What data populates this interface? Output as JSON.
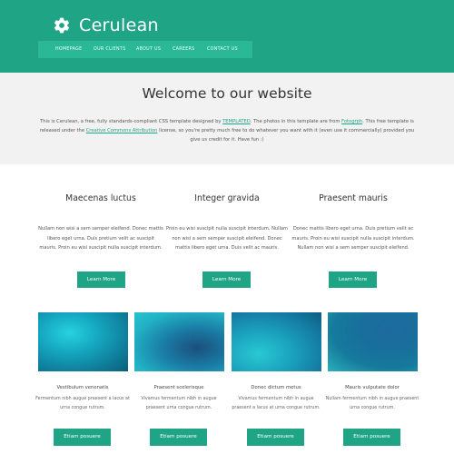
{
  "header": {
    "title": "Cerulean",
    "logo_icon": "gear-icon",
    "nav": [
      "Homepage",
      "Our Clients",
      "About Us",
      "Careers",
      "Contact Us"
    ]
  },
  "banner": {
    "heading": "Welcome to our website",
    "intro_1": "This is Cerulean, a free, fully standards-compliant CSS template designed by ",
    "link_1": "TEMPLATED",
    "intro_2": ". The photos in this template are from ",
    "link_2": "Fotogrph",
    "intro_3": ". This free template is released under the ",
    "link_3": "Creative Commons Attribution",
    "intro_4": " license, so you're pretty much free to do whatever you want with it (even use it commercially) provided you give us credit for it. Have fun :)"
  },
  "features": [
    {
      "title": "Maecenas luctus",
      "text": "Nullam non wisi a sem semper eleifend. Donec mattis libero eget urna. Duis pretium velit ac suscipit mauris. Proin eu wisi suscipit nulla suscipit interdum.",
      "button": "Learn More"
    },
    {
      "title": "Integer gravida",
      "text": "Proin eu wisi suscipit nulla suscipit interdum. Nullam non wisi a sem semper suscipit eleifend. Donec mattis libero eget urna. Duis velit ac mauris.",
      "button": "Learn More"
    },
    {
      "title": "Praesent mauris",
      "text": "Donec mattis libero eget urna. Duis pretium velit ac mauris. Proin eu wisi suscipit nulla suscipit interdum. Nullam non wisi a sem semper suscipit eleifend.",
      "button": "Learn More"
    }
  ],
  "gallery": [
    {
      "title": "Vestibulum venenatis",
      "text": "Fermentum nibh augue praesent a lacus at urna congue rutrum.",
      "button": "Etiam posuere"
    },
    {
      "title": "Praesent scelerisque",
      "text": "Vivamus fermentum nibh in augue praesent urna congue rutrum.",
      "button": "Etiam posuere"
    },
    {
      "title": "Donec dictum metus",
      "text": "Vivamus fermentum nibh in augue praesent a lacus at urna congue rutrum.",
      "button": "Etiam posuere"
    },
    {
      "title": "Mauris vulputate dolor",
      "text": "Nullam fermentum nibh in augue praesent urna congue rutrum.",
      "button": "Etiam posuere"
    }
  ],
  "colors": {
    "accent": "#1fa586",
    "nav_bar": "#2ab897",
    "banner_bg": "#f2f2f2"
  }
}
